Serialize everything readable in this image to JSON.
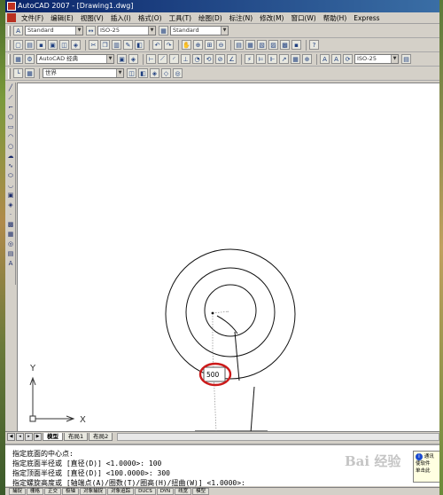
{
  "window": {
    "title": "AutoCAD 2007 - [Drawing1.dwg]"
  },
  "menubar": {
    "items": [
      "文件(F)",
      "编辑(E)",
      "视图(V)",
      "插入(I)",
      "格式(O)",
      "工具(T)",
      "绘图(D)",
      "标注(N)",
      "修改(M)",
      "窗口(W)",
      "帮助(H)",
      "Express"
    ]
  },
  "styles_toolbar": {
    "text_style": "Standard",
    "dim_style": "ISO-25",
    "table_style": "Standard"
  },
  "workspace_toolbar": {
    "workspace": "AutoCAD 经典",
    "dim_style2": "ISO-25"
  },
  "layers_toolbar": {
    "ucs": "世界"
  },
  "canvas": {
    "input_value": "500",
    "ucs_x_label": "X",
    "ucs_y_label": "Y",
    "highlight_color": "#cc1a1a"
  },
  "tabs": {
    "items": [
      "模型",
      "布局1",
      "布局2"
    ]
  },
  "command_window": {
    "lines": [
      "指定底面的中心点:",
      "指定底面半径或 [直径(D)] <1.0000>: 100",
      "指定顶面半径或 [直径(D)] <100.0000>: 300",
      "指定螺旋高度或 [轴端点(A)/圈数(T)/圈高(H)/扭曲(W)] <1.0000>:"
    ]
  },
  "status_bar": {
    "items": [
      "捕捉",
      "栅格",
      "正交",
      "极轴",
      "对象捕捉",
      "对象追踪",
      "DUCS",
      "DYN",
      "线宽",
      "模型"
    ]
  },
  "balloon": {
    "line1": "通讯",
    "line2": "使软件",
    "line3": "单击此"
  },
  "watermark": {
    "text": "Bai 经验"
  },
  "icons": [
    "app-icon",
    "new-icon",
    "open-icon",
    "save-icon",
    "print-icon",
    "undo-icon",
    "redo-icon",
    "zoom-icon",
    "line-icon",
    "circle-icon",
    "arc-icon",
    "polygon-icon",
    "rectangle-icon",
    "hatch-icon",
    "text-icon",
    "info-icon"
  ]
}
